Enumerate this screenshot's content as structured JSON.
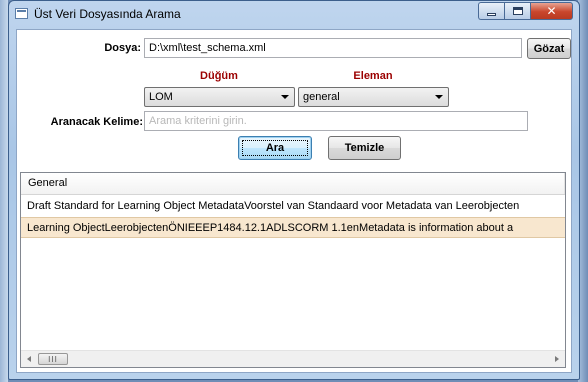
{
  "window": {
    "title": "Üst Veri Dosyasında Arama",
    "close_glyph": "✕"
  },
  "form": {
    "file_label": "Dosya:",
    "file_value": "D:\\xml\\test_schema.xml",
    "browse_label": "Gözat",
    "node_header": "Düğüm",
    "element_header": "Eleman",
    "node_selected": "LOM",
    "element_selected": "general",
    "search_label": "Aranacak Kelime:",
    "search_placeholder": "Arama kriterini girin.",
    "search_value": "",
    "search_button": "Ara",
    "clear_button": "Temizle"
  },
  "results": {
    "column_header": "General",
    "rows": [
      "Draft Standard for Learning Object MetadataVoorstel van Standaard voor Metadata van Leerobjecten",
      "Learning ObjectLeerobjectenÖNIEEEP1484.12.1ADLSCORM 1.1enMetadata is information about a"
    ],
    "selected_row": 1,
    "scroll_thumb_glyph": "III"
  },
  "colors": {
    "combo_header": "#9b0000",
    "selected_row": "#f8e7cf",
    "close_button": "#c9462c"
  },
  "icons": [
    "app-window-icon",
    "minimize-icon",
    "maximize-icon",
    "close-icon",
    "dropdown-arrow-icon",
    "scroll-left-icon",
    "scroll-right-icon"
  ]
}
